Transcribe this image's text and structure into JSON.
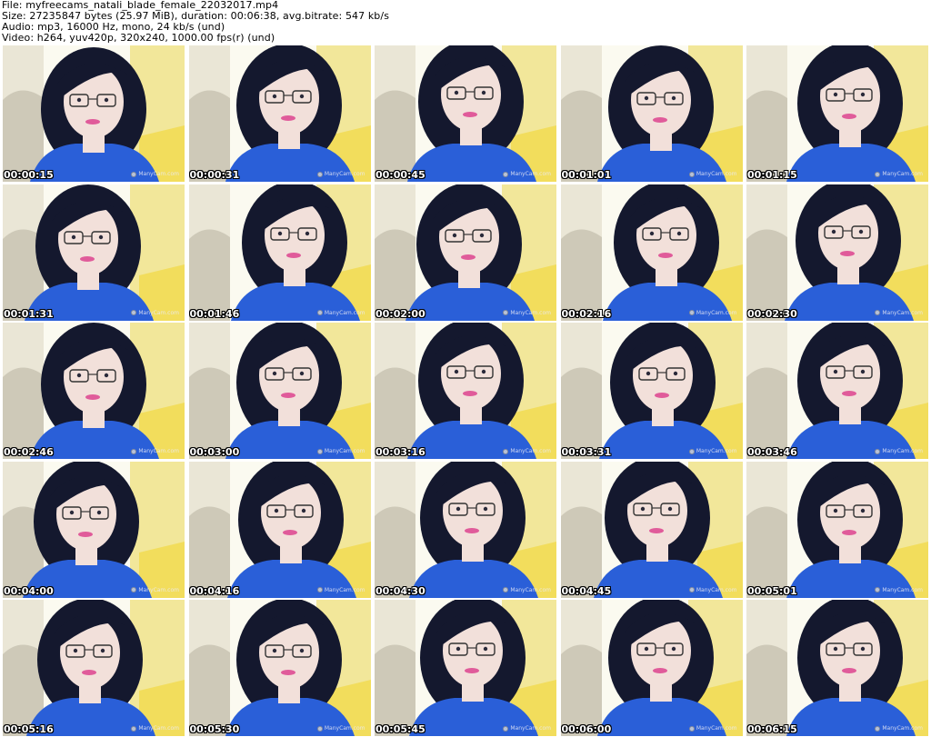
{
  "header": {
    "file_line": "File: myfreecams_natali_blade_female_22032017.mp4",
    "size_line": "Size: 27235847 bytes (25.97 MiB), duration: 00:06:38, avg.bitrate: 547 kb/s",
    "audio_line": "Audio: mp3, 16000 Hz, mono, 24 kb/s (und)",
    "video_line": "Video: h264, yuv420p, 320x240, 1000.00 fps(r) (und)"
  },
  "watermark_text": "ManyCam.com",
  "colors": {
    "background": "#ffffff",
    "wall_yellow": "#f2e79a",
    "window_light": "#fbfaf0",
    "shirt_blue": "#2a5fd8",
    "hair_dark": "#14182e",
    "skin": "#f2e0da",
    "lip_pink": "#e05b9a"
  },
  "thumbnails": [
    {
      "time": "00:00:15"
    },
    {
      "time": "00:00:31"
    },
    {
      "time": "00:00:45"
    },
    {
      "time": "00:01:01"
    },
    {
      "time": "00:01:15"
    },
    {
      "time": "00:01:31"
    },
    {
      "time": "00:01:46"
    },
    {
      "time": "00:02:00"
    },
    {
      "time": "00:02:16"
    },
    {
      "time": "00:02:30"
    },
    {
      "time": "00:02:46"
    },
    {
      "time": "00:03:00"
    },
    {
      "time": "00:03:16"
    },
    {
      "time": "00:03:31"
    },
    {
      "time": "00:03:46"
    },
    {
      "time": "00:04:00"
    },
    {
      "time": "00:04:16"
    },
    {
      "time": "00:04:30"
    },
    {
      "time": "00:04:45"
    },
    {
      "time": "00:05:01"
    },
    {
      "time": "00:05:16"
    },
    {
      "time": "00:05:30"
    },
    {
      "time": "00:05:45"
    },
    {
      "time": "00:06:00"
    },
    {
      "time": "00:06:15"
    }
  ]
}
